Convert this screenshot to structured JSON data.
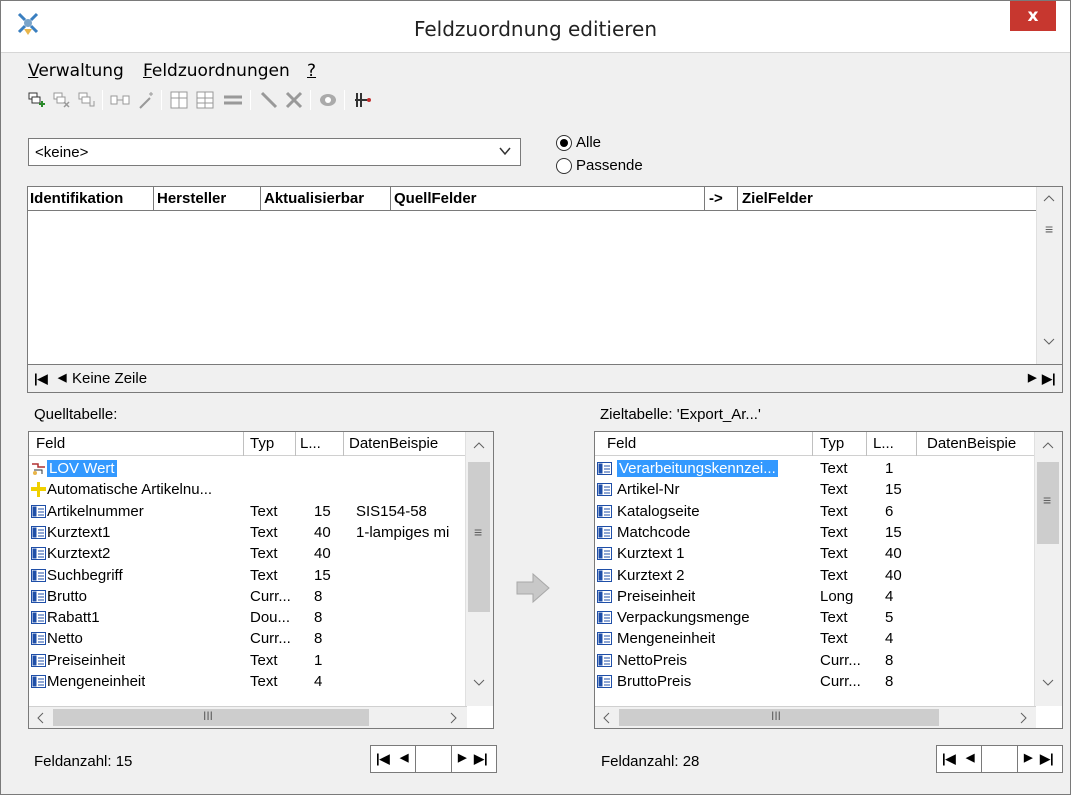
{
  "window": {
    "title": "Feldzuordnung editieren",
    "close_label": "x"
  },
  "menu": {
    "items": [
      {
        "label": "Verwaltung",
        "underline": "V"
      },
      {
        "label": "Feldzuordnungen",
        "underline": "F"
      },
      {
        "label": "?",
        "underline": "?"
      }
    ]
  },
  "toolbar": {
    "icons": [
      "add-row-icon",
      "delete-row-icon",
      "update-row-icon",
      "map-icon",
      "wand-icon",
      "table-icon",
      "table-edit-icon",
      "equals-icon",
      "line-icon",
      "cross-icon",
      "eye-icon",
      "run-icon"
    ]
  },
  "filter": {
    "combo_value": "<keine>",
    "radio_all": "Alle",
    "radio_matching": "Passende",
    "selected": "Alle"
  },
  "grid": {
    "columns": [
      "Identifikation",
      "Hersteller",
      "Aktualisierbar",
      "QuellFelder",
      "->",
      "ZielFelder"
    ],
    "status": "Keine Zeile"
  },
  "source": {
    "label": "Quelltabelle:",
    "columns": [
      "Feld",
      "Typ",
      "L...",
      "DatenBeispie"
    ],
    "rows": [
      {
        "icon": "lov-icon",
        "feld": "LOV Wert",
        "typ": "",
        "len": "",
        "sample": "",
        "selected": true
      },
      {
        "icon": "auto-icon",
        "feld": "Automatische Artikelnu...",
        "typ": "",
        "len": "",
        "sample": ""
      },
      {
        "icon": "field-icon",
        "feld": "Artikelnummer",
        "typ": "Text",
        "len": "15",
        "sample": "SIS154-58"
      },
      {
        "icon": "field-icon",
        "feld": "Kurztext1",
        "typ": "Text",
        "len": "40",
        "sample": "1-lampiges mi"
      },
      {
        "icon": "field-icon",
        "feld": "Kurztext2",
        "typ": "Text",
        "len": "40",
        "sample": ""
      },
      {
        "icon": "field-icon",
        "feld": "Suchbegriff",
        "typ": "Text",
        "len": "15",
        "sample": ""
      },
      {
        "icon": "field-icon",
        "feld": "Brutto",
        "typ": "Curr...",
        "len": "8",
        "sample": ""
      },
      {
        "icon": "field-icon",
        "feld": "Rabatt1",
        "typ": "Dou...",
        "len": "8",
        "sample": ""
      },
      {
        "icon": "field-icon",
        "feld": "Netto",
        "typ": "Curr...",
        "len": "8",
        "sample": ""
      },
      {
        "icon": "field-icon",
        "feld": "Preiseinheit",
        "typ": "Text",
        "len": "1",
        "sample": ""
      },
      {
        "icon": "field-icon",
        "feld": "Mengeneinheit",
        "typ": "Text",
        "len": "4",
        "sample": ""
      }
    ],
    "count": "Feldanzahl: 15"
  },
  "target": {
    "label": "Zieltabelle: 'Export_Ar...'",
    "columns": [
      "Feld",
      "Typ",
      "L...",
      "DatenBeispie"
    ],
    "rows": [
      {
        "feld": "Verarbeitungskennzei...",
        "typ": "Text",
        "len": "1",
        "selected": true
      },
      {
        "feld": "Artikel-Nr",
        "typ": "Text",
        "len": "15"
      },
      {
        "feld": "Katalogseite",
        "typ": "Text",
        "len": "6"
      },
      {
        "feld": "Matchcode",
        "typ": "Text",
        "len": "15"
      },
      {
        "feld": "Kurztext 1",
        "typ": "Text",
        "len": "40"
      },
      {
        "feld": "Kurztext 2",
        "typ": "Text",
        "len": "40"
      },
      {
        "feld": "Preiseinheit",
        "typ": "Long",
        "len": "4"
      },
      {
        "feld": "Verpackungsmenge",
        "typ": "Text",
        "len": "5"
      },
      {
        "feld": "Mengeneinheit",
        "typ": "Text",
        "len": "4"
      },
      {
        "feld": "NettoPreis",
        "typ": "Curr...",
        "len": "8"
      },
      {
        "feld": "BruttoPreis",
        "typ": "Curr...",
        "len": "8"
      }
    ],
    "count": "Feldanzahl: 28"
  },
  "scroll_glyph": "III",
  "colors": {
    "selection": "#3399ff",
    "close": "#c7372f",
    "field_icon": "#1f4fa8"
  }
}
